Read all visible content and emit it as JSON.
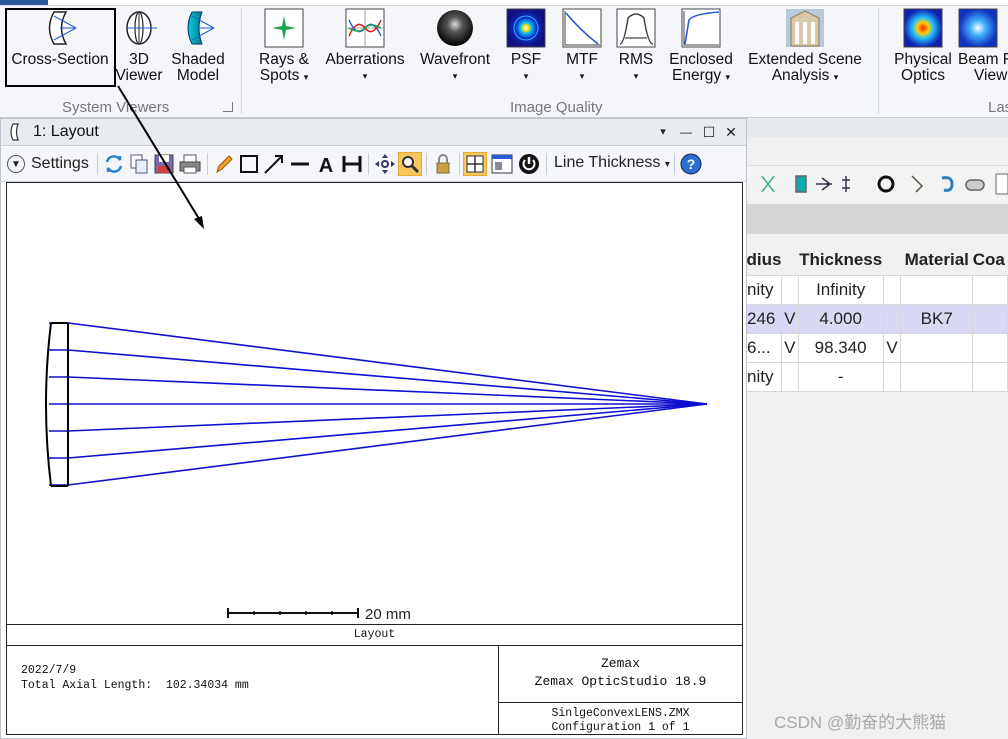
{
  "ribbon": {
    "buttons": {
      "cross_section": "Cross-Section",
      "viewer_3d": [
        "3D",
        "Viewer"
      ],
      "shaded_model": [
        "Shaded",
        "Model"
      ],
      "rays_spots": [
        "Rays &",
        "Spots"
      ],
      "aberrations": "Aberrations",
      "wavefront": "Wavefront",
      "psf": "PSF",
      "mtf": "MTF",
      "rms": "RMS",
      "enclosed_energy": [
        "Enclosed",
        "Energy"
      ],
      "extended_scene": [
        "Extended Scene",
        "Analysis"
      ],
      "physical_optics": [
        "Physical",
        "Optics"
      ],
      "beam_viewer": [
        "Beam F",
        "View"
      ]
    },
    "groups": {
      "system_viewers": "System Viewers",
      "image_quality": "Image Quality",
      "last_partial": "Las"
    },
    "dropdown_arrow": "▾"
  },
  "layout_window": {
    "title": "1: Layout",
    "settings_label": "Settings",
    "line_thickness_label": "Line Thickness",
    "window_controls": {
      "dropdown": "▾",
      "minimize": "—",
      "restore": "☐",
      "close": "✕"
    }
  },
  "plot": {
    "scale_bar_label": "20 mm"
  },
  "footer": {
    "title": "Layout",
    "date": "2022/7/9",
    "axial_length": "Total Axial Length:  102.34034 mm",
    "product_line1": "Zemax",
    "product_line2": "Zemax OpticStudio 18.9",
    "filename": "SinlgeConvexLENS.ZMX",
    "configuration": "Configuration 1 of 1"
  },
  "lens_data_editor": {
    "headers": [
      "dius",
      "",
      "Thickness",
      "",
      "Material",
      "Coa"
    ],
    "rows": [
      [
        "nity",
        "",
        "Infinity",
        "",
        "",
        ""
      ],
      [
        "246",
        "V",
        "4.000",
        "",
        "BK7",
        ""
      ],
      [
        "6...",
        "V",
        "98.340",
        "V",
        "",
        ""
      ],
      [
        "nity",
        "",
        "-",
        "",
        "",
        ""
      ]
    ],
    "selected_row": 1
  },
  "watermark": "CSDN @勤奋的大熊猫",
  "colors": {
    "ray_blue": "#1010d0",
    "lens_outline": "#000000",
    "selected_row": "#d9d9f5",
    "ribbon_bg": "#f4f6fa"
  }
}
